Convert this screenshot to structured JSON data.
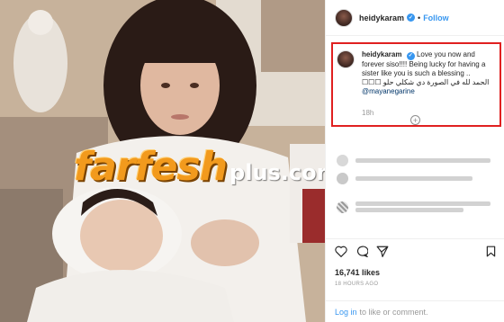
{
  "photo": {
    "watermark_main": "farfesh",
    "watermark_plus": "plus.com"
  },
  "post": {
    "username": "heidykaram",
    "separator": "•",
    "follow_label": "Follow",
    "caption": {
      "text_line1": "Love you now and forever siso!!!! Being lucky for having a sister like you is such a blessing ..",
      "arabic_line": "الحمد لله في الصورة دي شكلي حلو ☐☐☐",
      "mention": "@mayanegarine"
    },
    "caption_time": "18h",
    "likes": "16,741 likes",
    "posted_ago": "18 HOURS AGO",
    "login_link": "Log in",
    "login_rest": "to like or comment."
  },
  "colors": {
    "accent_blue": "#3897f0",
    "highlight_red": "#e02020",
    "watermark_orange": "#f29a1d"
  },
  "icons": [
    "verified-icon",
    "add-comment-icon",
    "heart-icon",
    "comment-icon",
    "share-icon",
    "bookmark-icon"
  ]
}
